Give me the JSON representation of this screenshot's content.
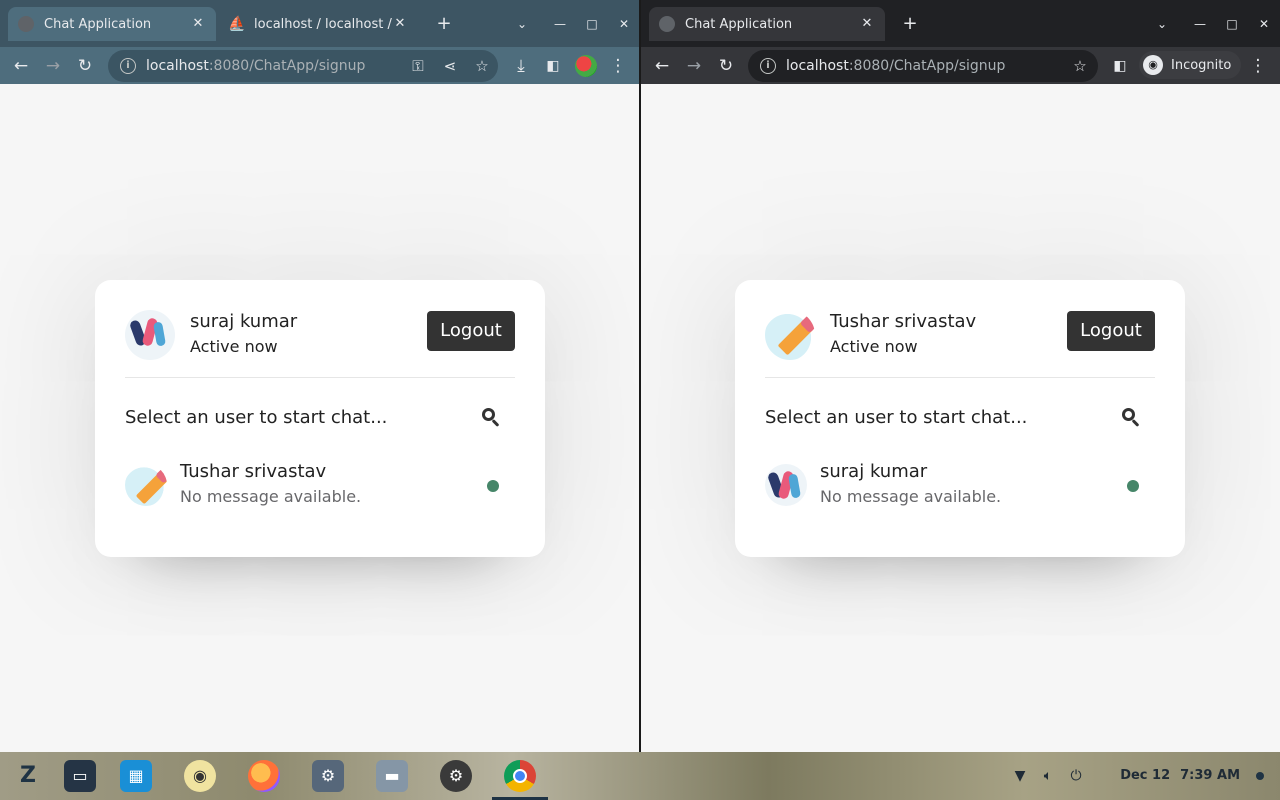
{
  "left_window": {
    "tabs": [
      {
        "title": "Chat Application",
        "close": "✕"
      },
      {
        "title": "localhost / localhost /",
        "close": "✕"
      }
    ],
    "url_host": "localhost",
    "url_path": ":8080/ChatApp/signup",
    "current_user": {
      "name": "suraj kumar",
      "status": "Active now"
    },
    "logout_label": "Logout",
    "search_prompt": "Select an user to start chat...",
    "users": [
      {
        "name": "Tushar srivastav",
        "message": "No message available.",
        "online": true
      }
    ]
  },
  "right_window": {
    "tabs": [
      {
        "title": "Chat Application",
        "close": "✕"
      }
    ],
    "url_host": "localhost",
    "url_path": ":8080/ChatApp/signup",
    "incognito_label": "Incognito",
    "current_user": {
      "name": "Tushar srivastav",
      "status": "Active now"
    },
    "logout_label": "Logout",
    "search_prompt": "Select an user to start chat...",
    "users": [
      {
        "name": "suraj kumar",
        "message": "No message available.",
        "online": true
      }
    ]
  },
  "taskbar": {
    "date": "Dec 12",
    "time": "7:39 AM"
  },
  "colors": {
    "online": "#468669",
    "logout_bg": "#333333",
    "page_bg": "#f6f6f6"
  }
}
